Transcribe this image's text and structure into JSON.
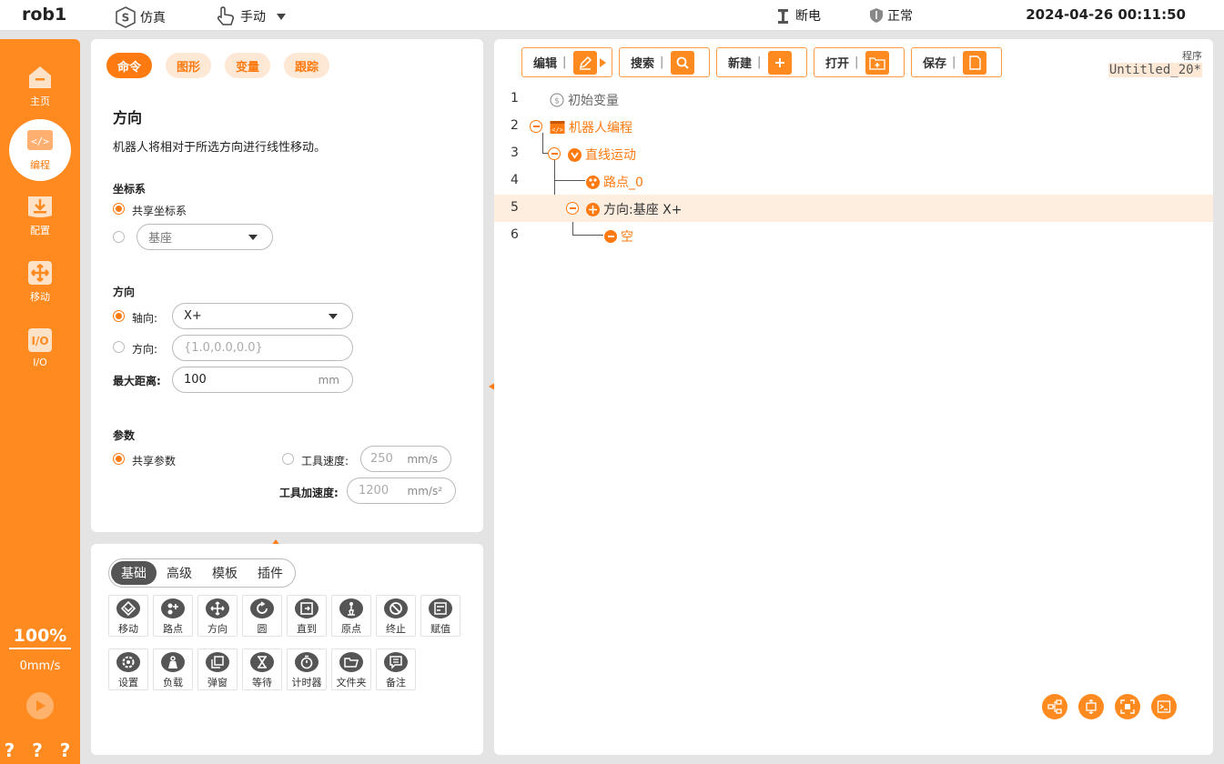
{
  "topbar": {
    "robot_name": "rob1",
    "sim_label": "仿真",
    "mode_label": "手动",
    "power_label": "断电",
    "status_label": "正常",
    "datetime": "2024-04-26 00:11:50"
  },
  "sidebar": {
    "items": [
      {
        "label": "主页",
        "icon": "home-icon"
      },
      {
        "label": "编程",
        "icon": "code-icon"
      },
      {
        "label": "配置",
        "icon": "download-config-icon"
      },
      {
        "label": "移动",
        "icon": "move-arrows-icon"
      },
      {
        "label": "I/O",
        "icon": "io-icon"
      }
    ],
    "speed_percent": "100%",
    "speed_value": "0mm/s",
    "bottom_text": "? ? ? ?"
  },
  "command_panel": {
    "tabs": [
      "命令",
      "图形",
      "变量",
      "跟踪"
    ],
    "title": "方向",
    "description": "机器人将相对于所选方向进行线性移动。",
    "coord_section": "坐标系",
    "coord_shared": "共享坐标系",
    "coord_select": "基座",
    "dir_section": "方向",
    "axis_label": "轴向:",
    "axis_value": "X+",
    "direction_label": "方向:",
    "direction_placeholder": "{1.0,0.0,0.0}",
    "max_dist_label": "最大距离:",
    "max_dist_value": "100",
    "max_dist_unit": "mm",
    "param_section": "参数",
    "param_shared": "共享参数",
    "tool_speed_label": "工具速度:",
    "tool_speed_value": "250",
    "tool_speed_unit": "mm/s",
    "tool_accel_label": "工具加速度:",
    "tool_accel_value": "1200",
    "tool_accel_unit": "mm/s²"
  },
  "palette": {
    "segments": [
      "基础",
      "高级",
      "模板",
      "插件"
    ],
    "row1": [
      "移动",
      "路点",
      "方向",
      "圆",
      "直到",
      "原点",
      "终止",
      "赋值"
    ],
    "row2": [
      "设置",
      "负载",
      "弹窗",
      "等待",
      "计时器",
      "文件夹",
      "备注"
    ]
  },
  "program": {
    "buttons": [
      "编辑",
      "搜索",
      "新建",
      "打开",
      "保存"
    ],
    "label": "程序",
    "name": "Untitled_20*",
    "lines": [
      {
        "n": "1",
        "text": "初始变量"
      },
      {
        "n": "2",
        "text": "机器人编程"
      },
      {
        "n": "3",
        "text": "直线运动"
      },
      {
        "n": "4",
        "text": "路点_0"
      },
      {
        "n": "5",
        "text": "方向:基座 X+"
      },
      {
        "n": "6",
        "text": "空"
      }
    ]
  },
  "colors": {
    "accent": "#ff7a10",
    "sidebar": "#ff8a1f"
  }
}
